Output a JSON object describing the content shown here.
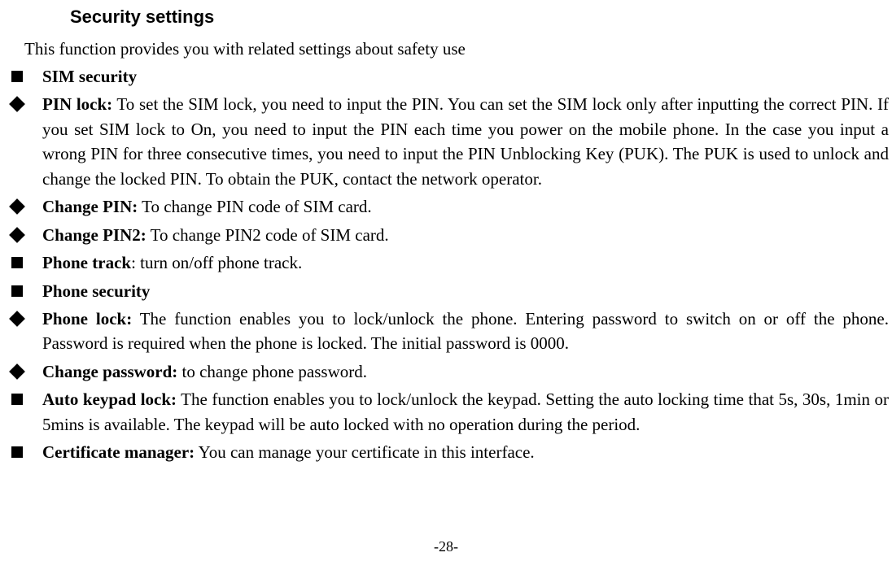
{
  "title": "Security settings",
  "intro": "This function provides you with related settings about safety use",
  "items": [
    {
      "bullet": "square",
      "bold": "SIM security",
      "text": ""
    },
    {
      "bullet": "diamond",
      "bold": "PIN lock:",
      "text": " To set the SIM lock, you need to input the PIN. You can set the SIM lock only after inputting the correct PIN. If you set SIM lock to On, you need to input the PIN each time you power on the mobile phone. In the case you input a wrong PIN for three consecutive times, you need to input the PIN Unblocking Key (PUK). The PUK is used to unlock and change the locked PIN. To obtain the PUK, contact the network operator."
    },
    {
      "bullet": "diamond",
      "bold": "Change PIN:",
      "text": " To change PIN code of SIM card."
    },
    {
      "bullet": "diamond",
      "bold": "Change PIN2:",
      "text": " To change PIN2 code of SIM card."
    },
    {
      "bullet": "square",
      "bold": "Phone track",
      "text": ": turn on/off phone track."
    },
    {
      "bullet": "square",
      "bold": "Phone security",
      "text": ""
    },
    {
      "bullet": "diamond",
      "bold": "Phone lock:",
      "text": " The function enables you to lock/unlock the phone. Entering password to switch on or off the phone. Password is required when the phone is locked. The initial password is 0000."
    },
    {
      "bullet": "diamond",
      "bold": "Change password:",
      "text": " to change phone password."
    },
    {
      "bullet": "square",
      "bold": "Auto keypad lock:",
      "text": " The function enables you to lock/unlock the keypad. Setting the auto locking time that 5s, 30s, 1min or 5mins is available. The keypad will be auto locked with no operation during the period."
    },
    {
      "bullet": "square",
      "bold": "Certificate manager:",
      "text": " You can manage your certificate in this interface."
    }
  ],
  "pageNumber": "-28-"
}
